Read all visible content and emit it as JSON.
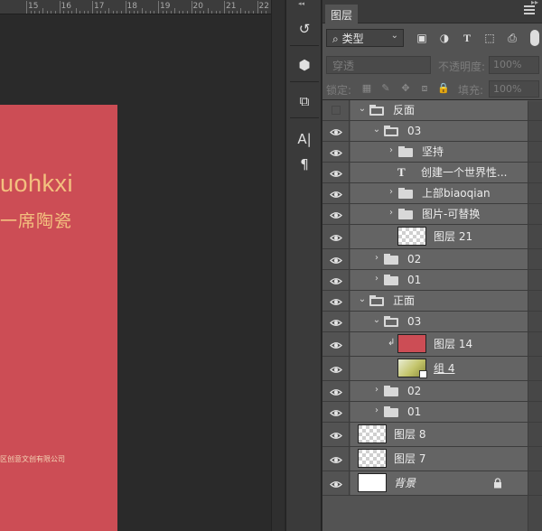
{
  "ruler": {
    "ticks": [
      "15",
      "16",
      "17",
      "18",
      "19",
      "20",
      "21",
      "22"
    ]
  },
  "canvas": {
    "line1": "uohkxi",
    "line2": "一席陶瓷",
    "line3": "区创意文创有限公司",
    "card_color": "#cc4d55",
    "text_color": "#f3c07f"
  },
  "tools": [
    {
      "icon": "history-icon",
      "glyph": "↺"
    },
    {
      "icon": "3d-cube-icon",
      "glyph": "⬢"
    },
    {
      "icon": "transform-icon",
      "glyph": "⧉"
    },
    {
      "icon": "character-icon",
      "glyph": "A|"
    },
    {
      "icon": "paragraph-icon",
      "glyph": "¶"
    }
  ],
  "panel": {
    "tab": "图层",
    "filter": {
      "selected": "类型"
    },
    "blend": {
      "mode": "穿透",
      "opacity_label": "不透明度:",
      "opacity_value": "100%"
    },
    "lock": {
      "label": "锁定:",
      "fill_label": "填充:",
      "fill_value": "100%"
    }
  },
  "layers": [
    {
      "name": "反面",
      "kind": "group",
      "open": true,
      "level": 0,
      "visible": false
    },
    {
      "name": "03",
      "kind": "group",
      "open": true,
      "level": 1,
      "visible": true
    },
    {
      "name": "坚持",
      "kind": "group",
      "open": false,
      "level": 2,
      "visible": true
    },
    {
      "name": "创建一个世界性...",
      "kind": "text",
      "level": 2,
      "visible": true
    },
    {
      "name": "上部biaoqian",
      "kind": "group",
      "open": false,
      "level": 2,
      "visible": true
    },
    {
      "name": "图片-可替换",
      "kind": "group",
      "open": false,
      "level": 2,
      "visible": true
    },
    {
      "name": "图层 21",
      "kind": "pixel",
      "thumb": "check",
      "level": 2,
      "visible": true
    },
    {
      "name": "02",
      "kind": "group",
      "open": false,
      "level": 1,
      "visible": true
    },
    {
      "name": "01",
      "kind": "group",
      "open": false,
      "level": 1,
      "visible": true
    },
    {
      "name": "正面",
      "kind": "group",
      "open": true,
      "level": 0,
      "visible": true
    },
    {
      "name": "03",
      "kind": "group",
      "open": true,
      "level": 1,
      "visible": true
    },
    {
      "name": "图层 14",
      "kind": "pixel",
      "thumb": "red",
      "clipped": true,
      "level": 2,
      "visible": true
    },
    {
      "name": "组 4",
      "kind": "smart",
      "thumb": "smart",
      "level": 2,
      "visible": true
    },
    {
      "name": "02",
      "kind": "group",
      "open": false,
      "level": 1,
      "visible": true
    },
    {
      "name": "01",
      "kind": "group",
      "open": false,
      "level": 1,
      "visible": true
    },
    {
      "name": "图层 8",
      "kind": "pixel",
      "thumb": "check",
      "level": 0,
      "visible": true
    },
    {
      "name": "图层 7",
      "kind": "pixel",
      "thumb": "check",
      "level": 0,
      "visible": true
    },
    {
      "name": "背景",
      "kind": "background",
      "thumb": "white",
      "locked": true,
      "level": 0,
      "visible": true
    }
  ]
}
